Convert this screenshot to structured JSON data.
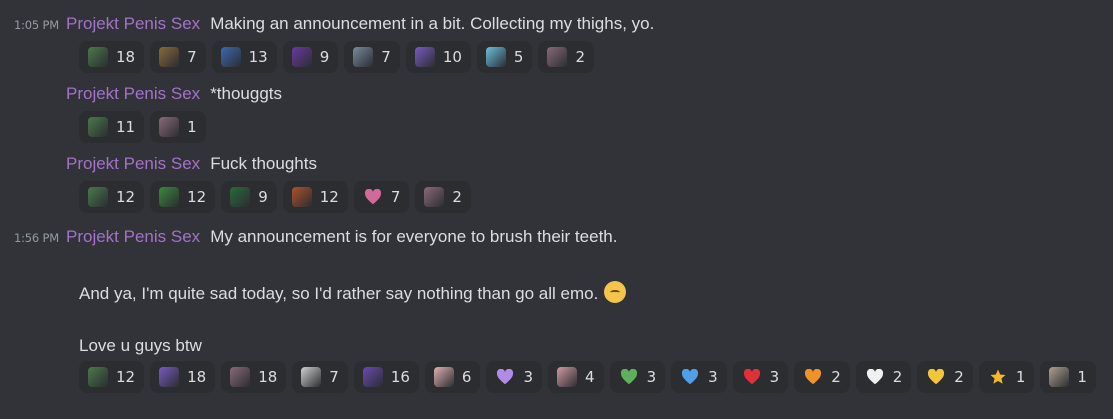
{
  "messages": [
    {
      "timestamp": "1:05 PM",
      "author": "Projekt Penis Sex",
      "text": "Making an announcement in a bit. Collecting my thighs, yo.",
      "reactions": [
        {
          "emoji": "cup-noodle-emoji",
          "color": "#4a7a4a",
          "count": "18"
        },
        {
          "emoji": "portrait-emoji",
          "color": "#8a6a3a",
          "count": "7"
        },
        {
          "emoji": "grid-face-emoji",
          "color": "#3a6ab0",
          "count": "13"
        },
        {
          "emoji": "satan-emoji",
          "color": "#6a3aa0",
          "count": "9"
        },
        {
          "emoji": "anime-face-emoji",
          "color": "#7a8aa0",
          "count": "7"
        },
        {
          "emoji": "purple-anime-emoji",
          "color": "#7a5ac0",
          "count": "10"
        },
        {
          "emoji": "blue-hair-emoji",
          "color": "#6ac0e0",
          "count": "5"
        },
        {
          "emoji": "hat-girl-emoji",
          "color": "#8a6a7a",
          "count": "2"
        }
      ]
    },
    {
      "timestamp": "",
      "author": "Projekt Penis Sex",
      "text": "*thouggts",
      "reactions": [
        {
          "emoji": "cup-noodle-emoji",
          "color": "#4a7a4a",
          "count": "11"
        },
        {
          "emoji": "hat-girl-emoji",
          "color": "#8a6a7a",
          "count": "1"
        }
      ]
    },
    {
      "timestamp": "",
      "author": "Projekt Penis Sex",
      "text": "Fuck thoughts",
      "reactions": [
        {
          "emoji": "cup-noodle-emoji",
          "color": "#4a7a4a",
          "count": "12"
        },
        {
          "emoji": "pepe-emoji",
          "color": "#3a8a3a",
          "count": "12"
        },
        {
          "emoji": "pepe-group-emoji",
          "color": "#2a6a3a",
          "count": "9"
        },
        {
          "emoji": "angry-face-emoji",
          "color": "#b0502a",
          "count": "12"
        },
        {
          "emoji": "pink-heart-bird-emoji",
          "color": "#d06a9a",
          "count": "7"
        },
        {
          "emoji": "hat-girl-emoji",
          "color": "#8a6a7a",
          "count": "2"
        }
      ]
    },
    {
      "timestamp": "1:56 PM",
      "author": "Projekt Penis Sex",
      "text": "My announcement is for everyone to brush their teeth.",
      "para1": "And ya, I'm quite sad today, so I'd rather say nothing than go all emo.",
      "para2": "Love u guys btw",
      "reactions": [
        {
          "emoji": "cup-noodle-emoji",
          "color": "#4a7a4a",
          "count": "12"
        },
        {
          "emoji": "purple-anime-emoji",
          "color": "#7a5ac0",
          "count": "18"
        },
        {
          "emoji": "hat-girl-emoji",
          "color": "#8a6a7a",
          "count": "18"
        },
        {
          "emoji": "sneaker-emoji",
          "color": "#d0d0d0",
          "count": "7"
        },
        {
          "emoji": "purple-hair-girl-emoji",
          "color": "#6a4ab0",
          "count": "16"
        },
        {
          "emoji": "blonde-girl-emoji",
          "color": "#e0b0b0",
          "count": "6"
        },
        {
          "emoji": "purple-heart-emoji",
          "color": "#b18ce6",
          "count": "3"
        },
        {
          "emoji": "pink-anime-emoji",
          "color": "#d09aa0",
          "count": "4"
        },
        {
          "emoji": "green-heart-emoji",
          "color": "#5fb05a",
          "count": "3"
        },
        {
          "emoji": "blue-heart-emoji",
          "color": "#4fa0e6",
          "count": "3"
        },
        {
          "emoji": "red-heart-emoji",
          "color": "#e0303a",
          "count": "3"
        },
        {
          "emoji": "orange-heart-emoji",
          "color": "#f0922a",
          "count": "2"
        },
        {
          "emoji": "white-heart-emoji",
          "color": "#f0f0f0",
          "count": "2"
        },
        {
          "emoji": "yellow-heart-emoji",
          "color": "#f4c53a",
          "count": "2"
        },
        {
          "emoji": "star-emoji",
          "color": "#f4b82a",
          "count": "1"
        },
        {
          "emoji": "cat-photo-emoji",
          "color": "#b0a090",
          "count": "1"
        }
      ]
    }
  ]
}
